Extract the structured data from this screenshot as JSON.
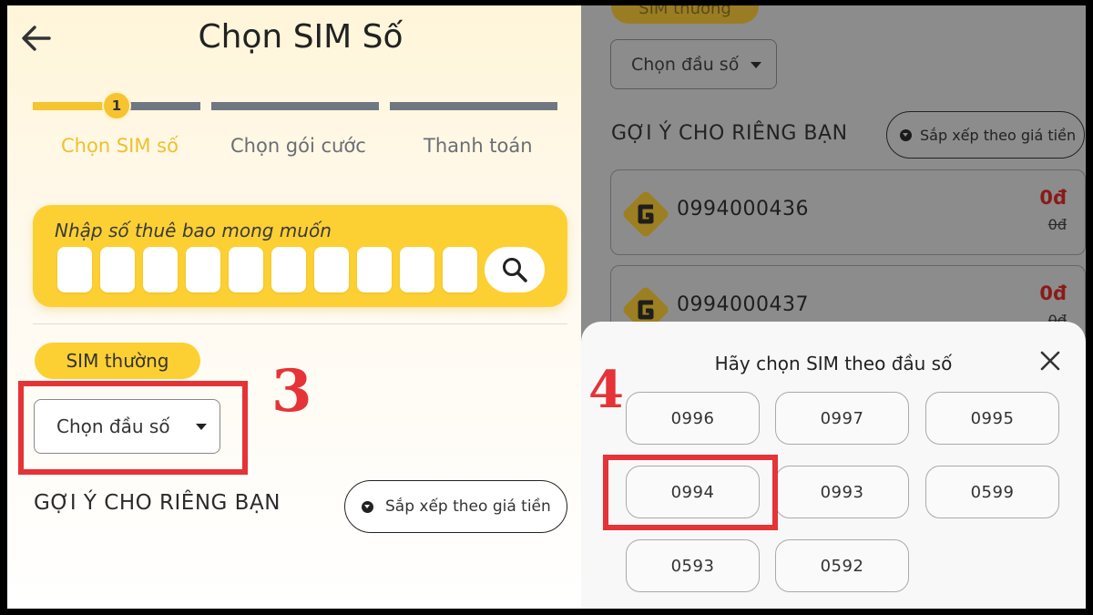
{
  "left": {
    "title": "Chọn SIM Số",
    "steps": [
      {
        "number": "1",
        "label": "Chọn SIM số"
      },
      {
        "label": "Chọn gói cước"
      },
      {
        "label": "Thanh toán"
      }
    ],
    "search": {
      "placeholder": "Nhập số thuê bao mong muốn",
      "digit_count": 10
    },
    "sim_type": "SIM thường",
    "prefix_select": "Chọn đầu số",
    "suggest_title": "GỢI Ý CHO RIÊNG BẠN",
    "sort_label": "Sắp xếp theo giá tiền",
    "step_marker": "3"
  },
  "right": {
    "sim_type": "SIM thường",
    "prefix_select": "Chọn đầu số",
    "suggest_title": "GỢI Ý CHO RIÊNG BẠN",
    "sort_label": "Sắp xếp theo giá tiền",
    "numbers": [
      {
        "number": "0994000436",
        "price": "0đ",
        "old_price": "0đ"
      },
      {
        "number": "0994000437",
        "price": "0đ",
        "old_price": "0đ"
      }
    ],
    "sheet": {
      "title": "Hãy chọn SIM theo đầu số",
      "prefixes": [
        "0996",
        "0997",
        "0995",
        "0994",
        "0993",
        "0599",
        "0593",
        "0592"
      ],
      "selected": "0994"
    },
    "step_marker": "4"
  },
  "colors": {
    "accent_yellow": "#fcd033",
    "highlight_red": "#e53337",
    "price_red": "#c0292a",
    "dim_overlay": "#8c8c8c"
  }
}
